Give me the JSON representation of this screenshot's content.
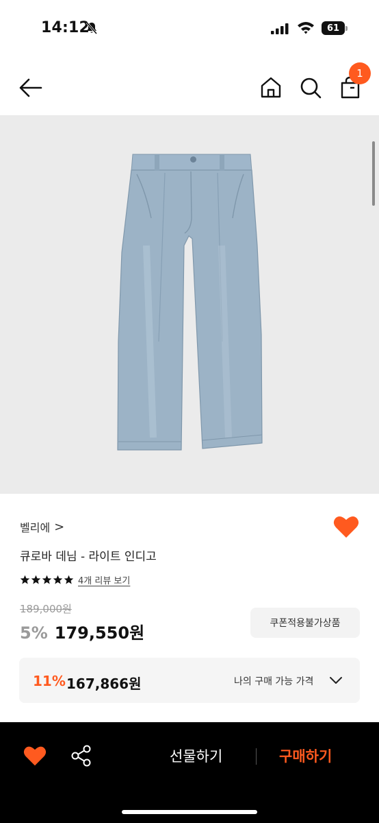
{
  "status_bar": {
    "time": "14:12",
    "battery": "61",
    "icons": [
      "bell-off-icon",
      "signal-icon",
      "wifi-icon",
      "battery-icon"
    ]
  },
  "nav": {
    "icons": [
      "back-arrow-icon",
      "home-icon",
      "search-icon",
      "shopping-bag-icon"
    ],
    "cart_count": "1"
  },
  "product": {
    "image_label": "light indigo denim trousers",
    "brand": "벨리에",
    "brand_chevron": ">",
    "title": "큐로바 데님 - 라이트 인디고",
    "rating_stars": 5,
    "review_link": "4개 리뷰 보기",
    "original_price": "189,000원",
    "discount": "5%",
    "price": "179,550원",
    "coupon_label": "쿠폰적용불가상품",
    "my_price": {
      "discount": "11%",
      "price": "167,866원",
      "label": "나의 구매 가능 가격"
    }
  },
  "bottom_bar": {
    "gift_label": "선물하기",
    "buy_label": "구매하기"
  },
  "colors": {
    "accent": "#ff5a1f",
    "denim": "#9cb3c6",
    "image_bg": "#ebebeb"
  }
}
